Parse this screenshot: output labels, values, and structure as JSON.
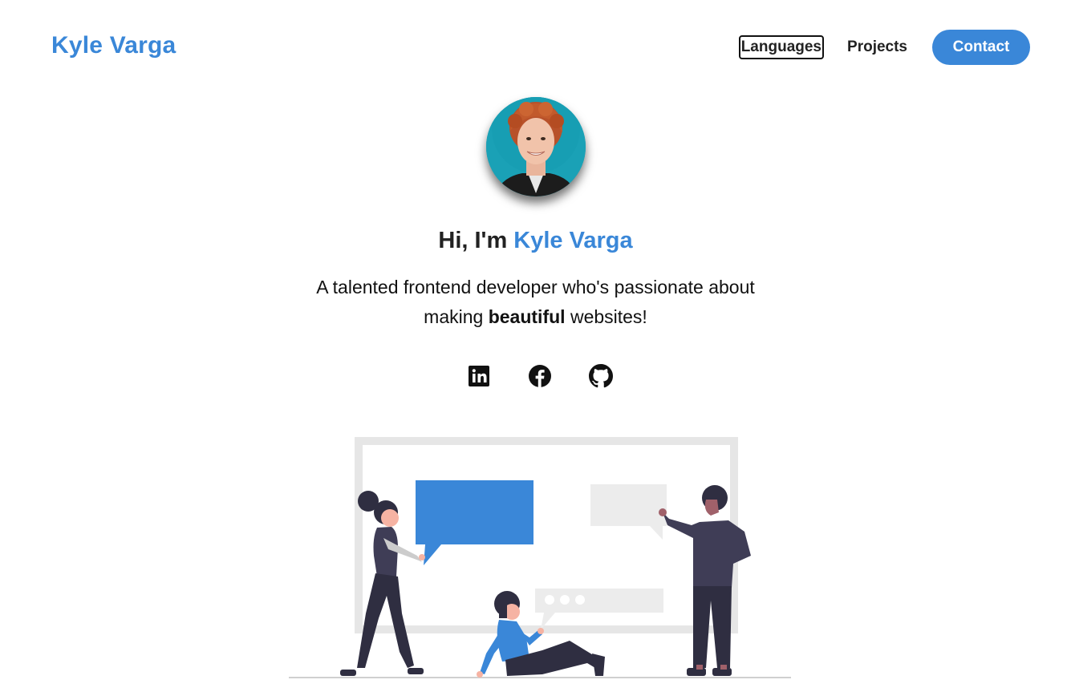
{
  "header": {
    "logo": "Kyle Varga",
    "nav": {
      "languages": "Languages",
      "projects": "Projects",
      "contact": "Contact"
    }
  },
  "hero": {
    "greeting": "Hi, I'm ",
    "name": "Kyle Varga",
    "tagline_part1": "A talented frontend developer who's passionate about making ",
    "tagline_bold": "beautiful",
    "tagline_part2": " websites!"
  },
  "socials": [
    {
      "icon": "linkedin-icon"
    },
    {
      "icon": "facebook-icon"
    },
    {
      "icon": "github-icon"
    }
  ],
  "colors": {
    "accent": "#3a87d8",
    "text": "#222222",
    "avatar_background": "#1aa1b6"
  }
}
